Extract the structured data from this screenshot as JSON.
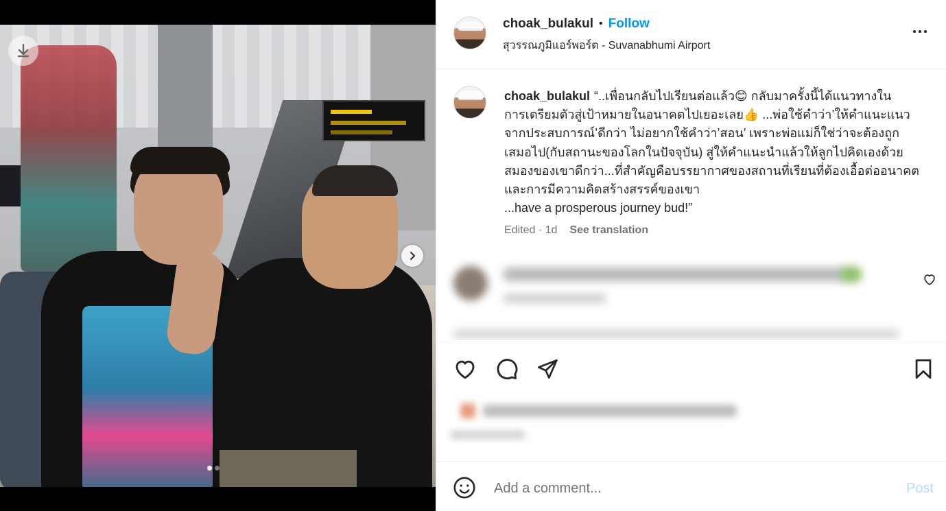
{
  "header": {
    "username": "choak_bulakul",
    "bullet": "•",
    "follow_label": "Follow",
    "location": "สุวรรณภูมิแอร์พอร์ต - Suvanabhumi Airport",
    "more_icon": "more-horizontal-icon"
  },
  "caption": {
    "username": "choak_bulakul",
    "text": "“..เพื่อนกลับไปเรียนต่อแล้ว😊 กลับมาครั้งนี้ได้แนวทางในการเตรียมตัวสู่เป้าหมายในอนาคตไปเยอะเลย👍 ...พ่อใช้คำว่า’ให้คำแนะแนวจากประสบการณ์’ดีกว่า ไม่อยากใช้คำว่า’สอน’ เพราะพ่อแม่ก็ใช่ว่าจะต้องถูกเสมอไป(กับสถานะของโลกในปัจจุบัน) สู่ให้คำแนะนำแล้วให้ลูกไปคิดเองด้วยสมองของเขาดีกว่า...ที่สำคัญคือบรรยากาศของสถานที่เรียนที่ต้องเอื้อต่ออนาคตและการมีความคิดสร้างสรรค์ของเขา\n...have a prosperous journey bud!”",
    "edited": "Edited · 1d",
    "see_translation": "See translation"
  },
  "media": {
    "download_icon": "download-icon",
    "next_icon": "chevron-right-icon",
    "slide_count": 2,
    "active_slide": 1
  },
  "actions": {
    "like_icon": "heart-icon",
    "comment_icon": "comment-icon",
    "share_icon": "send-icon",
    "save_icon": "bookmark-icon"
  },
  "add_comment": {
    "emoji_icon": "emoji-icon",
    "placeholder": "Add a comment...",
    "post_label": "Post"
  },
  "colors": {
    "link_blue": "#0095f6",
    "post_disabled": "#b2dffc",
    "text_primary": "#262626",
    "text_secondary": "#737373"
  }
}
